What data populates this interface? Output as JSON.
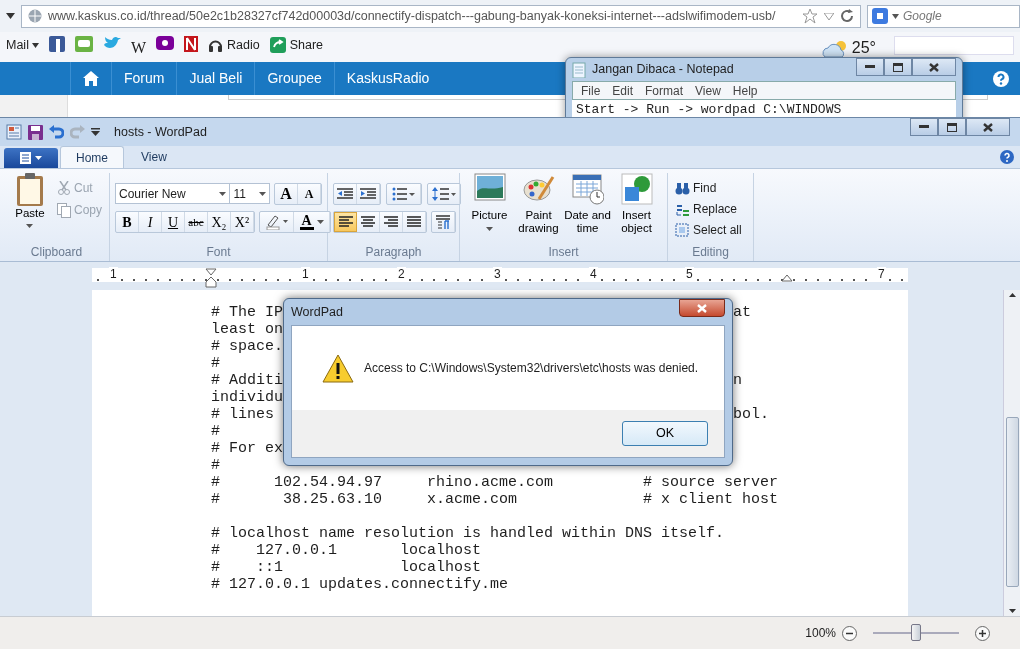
{
  "browser": {
    "url": "www.kaskus.co.id/thread/50e2c1b28327cf742d00003d/connectify-dispatch---gabung-banyak-koneksi-internet---adslwifimodem-usb/",
    "search_placeholder": "Google",
    "bookmarks": [
      {
        "kind": "menu",
        "label": "Mail"
      },
      {
        "kind": "letter",
        "label": "W"
      },
      {
        "kind": "link",
        "label": "Radio"
      },
      {
        "kind": "link",
        "label": "Share"
      }
    ],
    "weather": "25°",
    "site_nav": [
      "Forum",
      "Jual Beli",
      "Groupee",
      "KaskusRadio"
    ]
  },
  "notepad": {
    "title": "Jangan Dibaca - Notepad",
    "menu": [
      "File",
      "Edit",
      "Format",
      "View",
      "Help"
    ],
    "text": "Start -> Run -> wordpad C:\\WINDOWS"
  },
  "wordpad": {
    "title": "hosts - WordPad",
    "tabs": [
      {
        "label": "Home",
        "selected": true
      },
      {
        "label": "View",
        "selected": false
      }
    ],
    "clipboard": {
      "label": "Clipboard",
      "paste": "Paste",
      "items": [
        {
          "label": "Cut",
          "disabled": true
        },
        {
          "label": "Copy",
          "disabled": true
        }
      ]
    },
    "font": {
      "label": "Font",
      "family": "Courier New",
      "size": "11",
      "grow": "A",
      "shrink": "A",
      "styles": [
        "B",
        "I",
        "U",
        "abc",
        "X₂",
        "X²"
      ],
      "color_glyph": "A"
    },
    "paragraph": {
      "label": "Paragraph",
      "align_buttons": [
        {
          "selected": true
        },
        {
          "selected": false
        },
        {
          "selected": false
        },
        {
          "selected": false
        }
      ]
    },
    "insert": {
      "label": "Insert",
      "items": [
        {
          "label": "Picture",
          "dropdown": true
        },
        {
          "label": "Paint drawing",
          "dropdown": false
        },
        {
          "label": "Date and time",
          "dropdown": false
        },
        {
          "label": "Insert object",
          "dropdown": false
        }
      ]
    },
    "editing": {
      "label": "Editing",
      "items": [
        "Find",
        "Replace",
        "Select all"
      ]
    },
    "ruler": [
      "1",
      "1",
      "2",
      "3",
      "4",
      "5",
      "7"
    ],
    "document": {
      "blocks": [
        [
          {
            "text": "# The IP",
            "tail": "at"
          },
          {
            "text": "least on"
          },
          {
            "text": "# space."
          },
          {
            "text": "#"
          },
          {
            "text": "# Additi",
            "tail": "n"
          },
          {
            "text": "individu"
          },
          {
            "text": "# lines",
            "tail": "bol."
          },
          {
            "text": "#"
          },
          {
            "text": "# For ex"
          },
          {
            "text": "#"
          },
          {
            "text": "#      102.54.94.97     rhino.acme.com          # source server"
          },
          {
            "text": "#       38.25.63.10     x.acme.com              # x client host"
          }
        ],
        [
          {
            "text": "# localhost name resolution is handled within DNS itself."
          },
          {
            "text": "#    127.0.0.1       localhost"
          },
          {
            "text": "#    ::1             localhost"
          },
          {
            "text": "# 127.0.0.1 updates.connectify.me"
          }
        ]
      ]
    },
    "zoom": {
      "reading": "100%",
      "level": 0.5
    }
  },
  "dialog": {
    "title": "WordPad",
    "message": "Access to C:\\Windows\\System32\\drivers\\etc\\hosts was denied.",
    "button": "OK"
  }
}
